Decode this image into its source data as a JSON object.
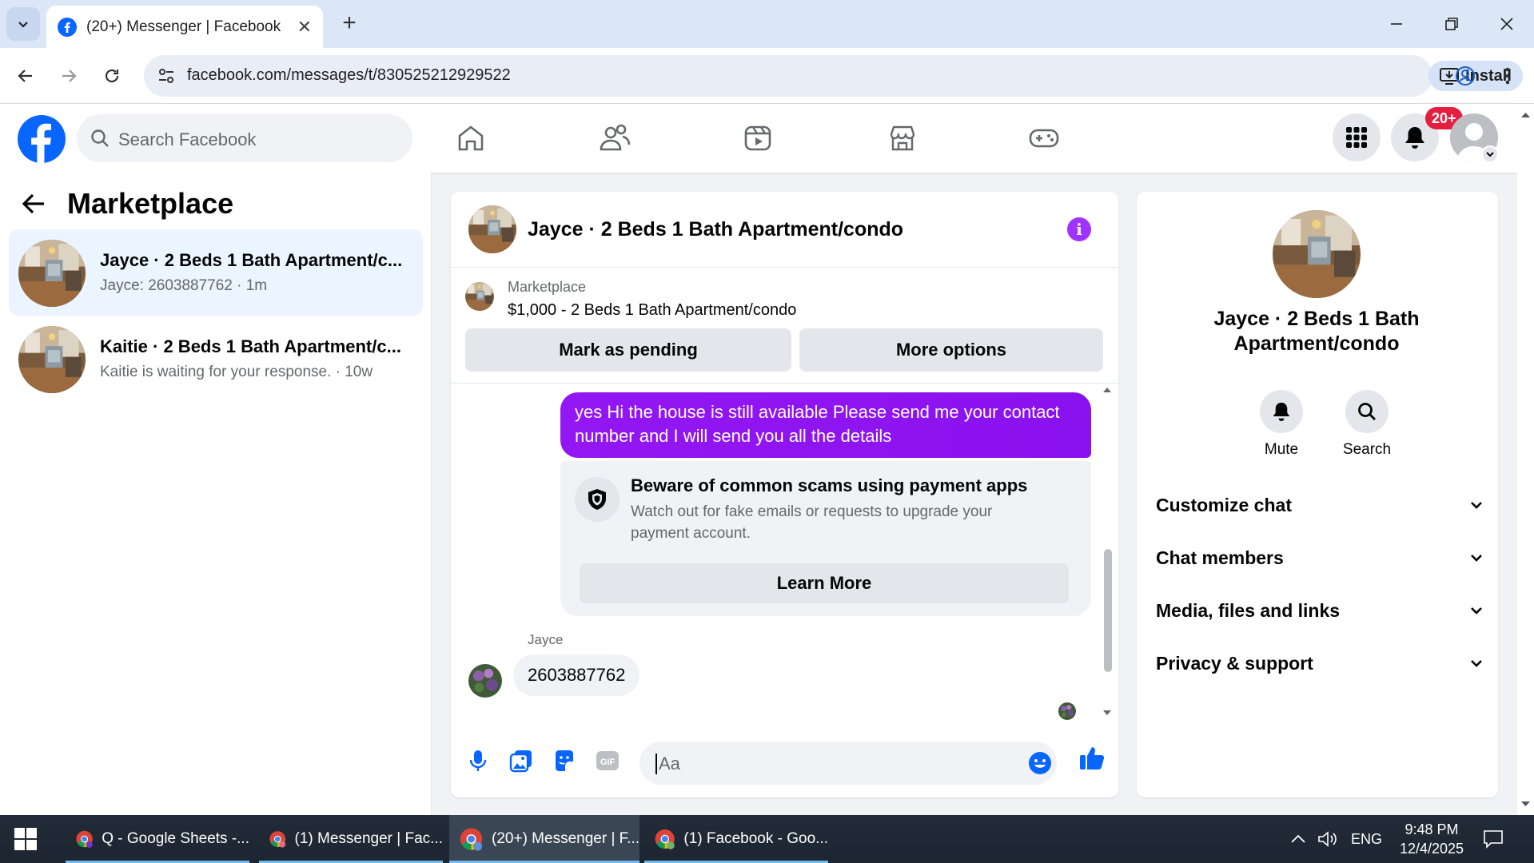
{
  "browser": {
    "tab_title": "(20+) Messenger | Facebook",
    "url": "facebook.com/messages/t/830525212929522",
    "install_label": "Install"
  },
  "fb": {
    "search_placeholder": "Search Facebook",
    "notification_badge": "20+"
  },
  "left": {
    "title": "Marketplace",
    "conversations": [
      {
        "name": "Jayce · 2 Beds 1 Bath Apartment/c...",
        "preview": "Jayce: 2603887762 · 1m",
        "active": true
      },
      {
        "name": "Kaitie · 2 Beds 1 Bath Apartment/c...",
        "preview": "Kaitie is waiting for your response. · 10w",
        "active": false
      }
    ]
  },
  "chat": {
    "title": "Jayce · 2 Beds 1 Bath Apartment/condo",
    "marketplace_label": "Marketplace",
    "listing": "$1,000 - 2 Beds 1 Bath Apartment/condo",
    "mark_pending": "Mark as pending",
    "more_options": "More options",
    "outgoing_message": "yes Hi the house is still available Please send me your contact number and I will send you all the details",
    "warning_title": "Beware of common scams using payment apps",
    "warning_body": "Watch out for fake emails or requests to upgrade your payment account.",
    "learn_more": "Learn More",
    "sender_name": "Jayce",
    "incoming_message": "2603887762",
    "composer_placeholder": "Aa"
  },
  "right": {
    "name": "Jayce · 2 Beds 1 Bath Apartment/condo",
    "mute": "Mute",
    "search": "Search",
    "sections": [
      "Customize chat",
      "Chat members",
      "Media, files and links",
      "Privacy & support"
    ]
  },
  "taskbar": {
    "apps": [
      {
        "label": "Q - Google Sheets -...",
        "active": false
      },
      {
        "label": "(1) Messenger | Fac...",
        "active": false
      },
      {
        "label": "(20+) Messenger | F...",
        "active": true
      },
      {
        "label": "(1) Facebook - Goo...",
        "active": false
      }
    ],
    "language": "ENG",
    "time": "9:48 PM",
    "date": "12/4/2025"
  },
  "colors": {
    "fb_blue": "#0866ff",
    "messenger_purple": "#8a12ee",
    "badge_red": "#e41e3f",
    "active_conv": "#ebf5ff"
  }
}
